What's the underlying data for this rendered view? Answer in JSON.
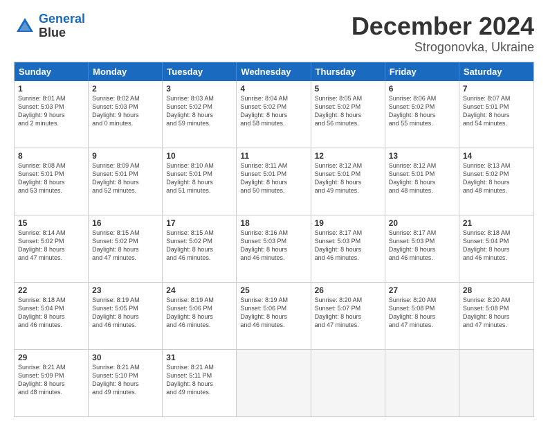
{
  "logo": {
    "line1": "General",
    "line2": "Blue"
  },
  "title": "December 2024",
  "subtitle": "Strogonovka, Ukraine",
  "days_of_week": [
    "Sunday",
    "Monday",
    "Tuesday",
    "Wednesday",
    "Thursday",
    "Friday",
    "Saturday"
  ],
  "weeks": [
    [
      {
        "day": "1",
        "info": "Sunrise: 8:01 AM\nSunset: 5:03 PM\nDaylight: 9 hours\nand 2 minutes."
      },
      {
        "day": "2",
        "info": "Sunrise: 8:02 AM\nSunset: 5:03 PM\nDaylight: 9 hours\nand 0 minutes."
      },
      {
        "day": "3",
        "info": "Sunrise: 8:03 AM\nSunset: 5:02 PM\nDaylight: 8 hours\nand 59 minutes."
      },
      {
        "day": "4",
        "info": "Sunrise: 8:04 AM\nSunset: 5:02 PM\nDaylight: 8 hours\nand 58 minutes."
      },
      {
        "day": "5",
        "info": "Sunrise: 8:05 AM\nSunset: 5:02 PM\nDaylight: 8 hours\nand 56 minutes."
      },
      {
        "day": "6",
        "info": "Sunrise: 8:06 AM\nSunset: 5:02 PM\nDaylight: 8 hours\nand 55 minutes."
      },
      {
        "day": "7",
        "info": "Sunrise: 8:07 AM\nSunset: 5:01 PM\nDaylight: 8 hours\nand 54 minutes."
      }
    ],
    [
      {
        "day": "8",
        "info": "Sunrise: 8:08 AM\nSunset: 5:01 PM\nDaylight: 8 hours\nand 53 minutes."
      },
      {
        "day": "9",
        "info": "Sunrise: 8:09 AM\nSunset: 5:01 PM\nDaylight: 8 hours\nand 52 minutes."
      },
      {
        "day": "10",
        "info": "Sunrise: 8:10 AM\nSunset: 5:01 PM\nDaylight: 8 hours\nand 51 minutes."
      },
      {
        "day": "11",
        "info": "Sunrise: 8:11 AM\nSunset: 5:01 PM\nDaylight: 8 hours\nand 50 minutes."
      },
      {
        "day": "12",
        "info": "Sunrise: 8:12 AM\nSunset: 5:01 PM\nDaylight: 8 hours\nand 49 minutes."
      },
      {
        "day": "13",
        "info": "Sunrise: 8:12 AM\nSunset: 5:01 PM\nDaylight: 8 hours\nand 48 minutes."
      },
      {
        "day": "14",
        "info": "Sunrise: 8:13 AM\nSunset: 5:02 PM\nDaylight: 8 hours\nand 48 minutes."
      }
    ],
    [
      {
        "day": "15",
        "info": "Sunrise: 8:14 AM\nSunset: 5:02 PM\nDaylight: 8 hours\nand 47 minutes."
      },
      {
        "day": "16",
        "info": "Sunrise: 8:15 AM\nSunset: 5:02 PM\nDaylight: 8 hours\nand 47 minutes."
      },
      {
        "day": "17",
        "info": "Sunrise: 8:15 AM\nSunset: 5:02 PM\nDaylight: 8 hours\nand 46 minutes."
      },
      {
        "day": "18",
        "info": "Sunrise: 8:16 AM\nSunset: 5:03 PM\nDaylight: 8 hours\nand 46 minutes."
      },
      {
        "day": "19",
        "info": "Sunrise: 8:17 AM\nSunset: 5:03 PM\nDaylight: 8 hours\nand 46 minutes."
      },
      {
        "day": "20",
        "info": "Sunrise: 8:17 AM\nSunset: 5:03 PM\nDaylight: 8 hours\nand 46 minutes."
      },
      {
        "day": "21",
        "info": "Sunrise: 8:18 AM\nSunset: 5:04 PM\nDaylight: 8 hours\nand 46 minutes."
      }
    ],
    [
      {
        "day": "22",
        "info": "Sunrise: 8:18 AM\nSunset: 5:04 PM\nDaylight: 8 hours\nand 46 minutes."
      },
      {
        "day": "23",
        "info": "Sunrise: 8:19 AM\nSunset: 5:05 PM\nDaylight: 8 hours\nand 46 minutes."
      },
      {
        "day": "24",
        "info": "Sunrise: 8:19 AM\nSunset: 5:06 PM\nDaylight: 8 hours\nand 46 minutes."
      },
      {
        "day": "25",
        "info": "Sunrise: 8:19 AM\nSunset: 5:06 PM\nDaylight: 8 hours\nand 46 minutes."
      },
      {
        "day": "26",
        "info": "Sunrise: 8:20 AM\nSunset: 5:07 PM\nDaylight: 8 hours\nand 47 minutes."
      },
      {
        "day": "27",
        "info": "Sunrise: 8:20 AM\nSunset: 5:08 PM\nDaylight: 8 hours\nand 47 minutes."
      },
      {
        "day": "28",
        "info": "Sunrise: 8:20 AM\nSunset: 5:08 PM\nDaylight: 8 hours\nand 47 minutes."
      }
    ],
    [
      {
        "day": "29",
        "info": "Sunrise: 8:21 AM\nSunset: 5:09 PM\nDaylight: 8 hours\nand 48 minutes."
      },
      {
        "day": "30",
        "info": "Sunrise: 8:21 AM\nSunset: 5:10 PM\nDaylight: 8 hours\nand 49 minutes."
      },
      {
        "day": "31",
        "info": "Sunrise: 8:21 AM\nSunset: 5:11 PM\nDaylight: 8 hours\nand 49 minutes."
      },
      {
        "day": "",
        "info": ""
      },
      {
        "day": "",
        "info": ""
      },
      {
        "day": "",
        "info": ""
      },
      {
        "day": "",
        "info": ""
      }
    ]
  ]
}
